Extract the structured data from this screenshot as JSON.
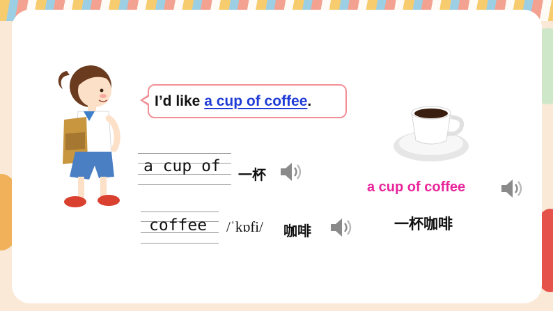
{
  "bubble": {
    "prefix": "I’d like ",
    "highlight": "a cup of coffee",
    "suffix": "."
  },
  "phrases": [
    {
      "handwritten": "a cup of",
      "chinese": "一杯"
    },
    {
      "handwritten": "coffee",
      "phonetic": "/ˈkɒfi/",
      "chinese": "咖啡"
    }
  ],
  "summary": {
    "english": "a cup of coffee",
    "chinese": "一杯咖啡"
  },
  "colors": {
    "highlight": "#1f3bd6",
    "pink": "#e8259b",
    "bubble_border": "#f28f96"
  },
  "icons": [
    "speaker-icon",
    "girl-illustration",
    "coffee-cup-illustration"
  ]
}
